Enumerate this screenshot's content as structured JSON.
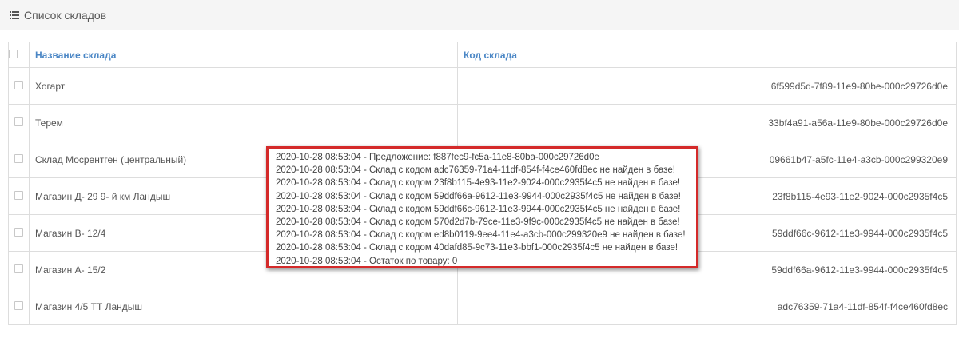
{
  "header": {
    "icon": "list-icon",
    "title": "Список складов"
  },
  "table": {
    "columns": {
      "name": "Название склада",
      "code": "Код склада"
    },
    "rows": [
      {
        "name": "Хогарт",
        "code": "6f599d5d-7f89-11e9-80be-000c29726d0e"
      },
      {
        "name": "Терем",
        "code": "33bf4a91-a56a-11e9-80be-000c29726d0e"
      },
      {
        "name": "Склад Мосрентген (центральный)",
        "code": "09661b47-a5fc-11e4-a3cb-000c299320e9"
      },
      {
        "name": "Магазин Д- 29 9- й км Ландыш",
        "code": "23f8b115-4e93-11e2-9024-000c2935f4c5"
      },
      {
        "name": "Магазин В- 12/4",
        "code": "59ddf66c-9612-11e3-9944-000c2935f4c5"
      },
      {
        "name": "Магазин А- 15/2",
        "code": "59ddf66a-9612-11e3-9944-000c2935f4c5"
      },
      {
        "name": "Магазин 4/5 ТТ Ландыш",
        "code": "adc76359-71a4-11df-854f-f4ce460fd8ec"
      }
    ]
  },
  "log": {
    "border_color": "#d42a2a",
    "lines": [
      "2020-10-28 08:53:04 - Предложение: f887fec9-fc5a-11e8-80ba-000c29726d0e",
      "2020-10-28 08:53:04 - Склад с кодом adc76359-71a4-11df-854f-f4ce460fd8ec не найден в базе!",
      "2020-10-28 08:53:04 - Склад с кодом 23f8b115-4e93-11e2-9024-000c2935f4c5 не найден в базе!",
      "2020-10-28 08:53:04 - Склад с кодом 59ddf66a-9612-11e3-9944-000c2935f4c5 не найден в базе!",
      "2020-10-28 08:53:04 - Склад с кодом 59ddf66c-9612-11e3-9944-000c2935f4c5 не найден в базе!",
      "2020-10-28 08:53:04 - Склад с кодом 570d2d7b-79ce-11e3-9f9c-000c2935f4c5 не найден в базе!",
      "2020-10-28 08:53:04 - Склад с кодом ed8b0119-9ee4-11e4-a3cb-000c299320e9 не найден в базе!",
      "2020-10-28 08:53:04 - Склад с кодом 40dafd85-9c73-11e3-bbf1-000c2935f4c5 не найден в базе!",
      "2020-10-28 08:53:04 - Остаток по товару: 0"
    ]
  }
}
